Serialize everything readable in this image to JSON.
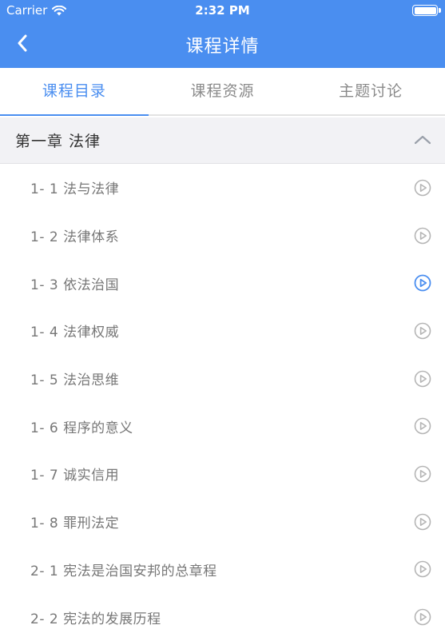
{
  "status_bar": {
    "carrier": "Carrier",
    "time": "2:32 PM"
  },
  "nav": {
    "title": "课程详情",
    "back_icon": "chevron-left-icon"
  },
  "tabs": [
    {
      "label": "课程目录",
      "active": true
    },
    {
      "label": "课程资源",
      "active": false
    },
    {
      "label": "主题讨论",
      "active": false
    }
  ],
  "chapter": {
    "title": "第一章 法律",
    "expanded": true
  },
  "lessons": [
    {
      "label": "1- 1 法与法律",
      "playing": false
    },
    {
      "label": "1- 2 法律体系",
      "playing": false
    },
    {
      "label": "1- 3 依法治国",
      "playing": true
    },
    {
      "label": "1- 4 法律权威",
      "playing": false
    },
    {
      "label": "1- 5 法治思维",
      "playing": false
    },
    {
      "label": "1- 6 程序的意义",
      "playing": false
    },
    {
      "label": "1- 7 诚实信用",
      "playing": false
    },
    {
      "label": "1- 8 罪刑法定",
      "playing": false
    },
    {
      "label": "2- 1 宪法是治国安邦的总章程",
      "playing": false
    },
    {
      "label": "2- 2 宪法的发展历程",
      "playing": false
    }
  ],
  "colors": {
    "accent": "#4a8ef0",
    "inactive_icon": "#b5b5b5"
  }
}
